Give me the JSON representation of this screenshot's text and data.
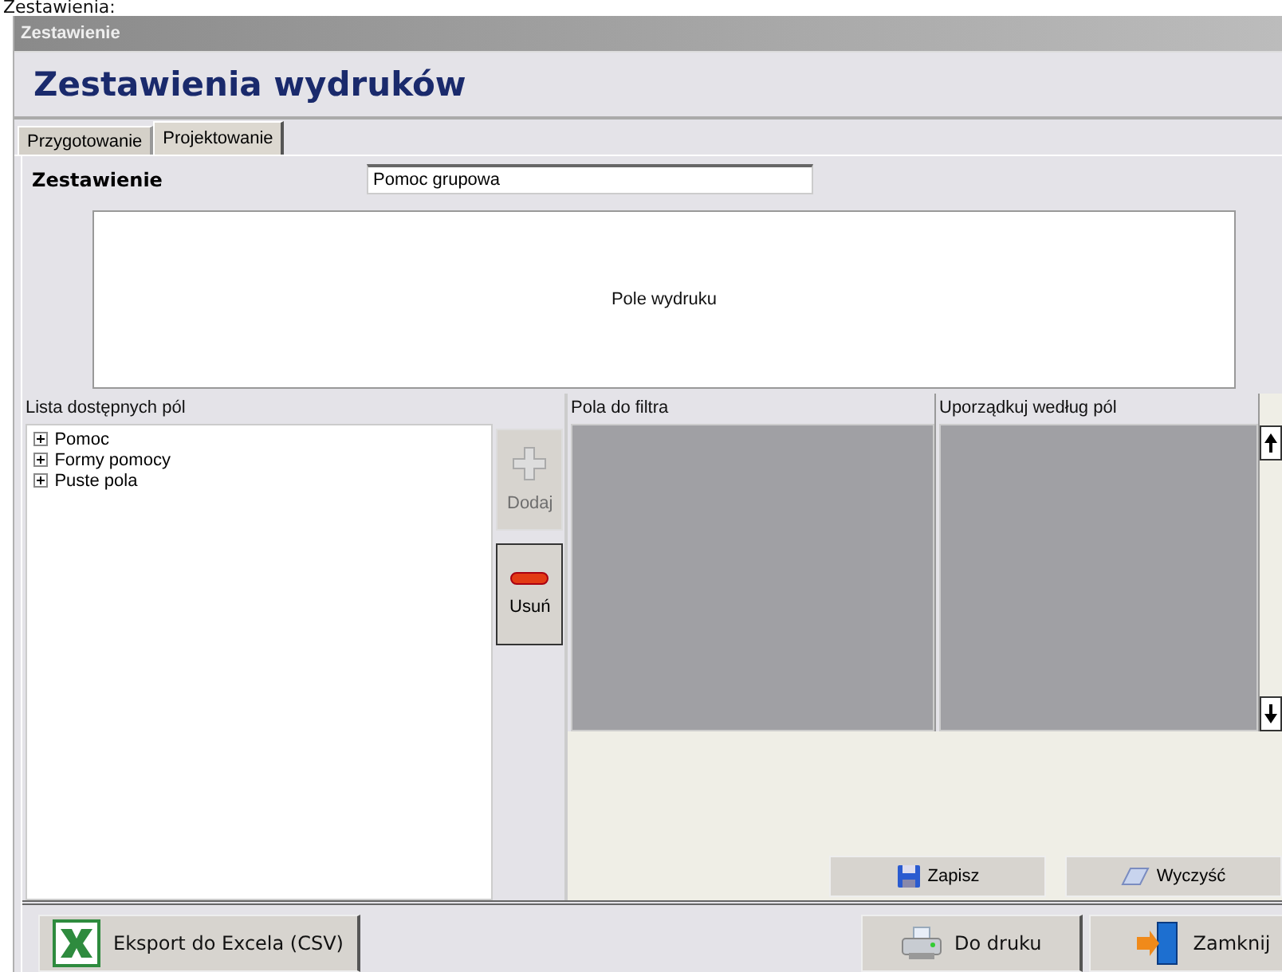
{
  "caption": "Zestawienia:",
  "window": {
    "title": "Zestawienie"
  },
  "heading": "Zestawienia wydruków",
  "tabs": [
    {
      "label": "Przygotowanie",
      "selected": false
    },
    {
      "label": "Projektowanie",
      "selected": true
    }
  ],
  "report": {
    "label": "Zestawienie",
    "value": "Pomoc grupowa"
  },
  "print_area": {
    "label": "Pole wydruku"
  },
  "fields_list": {
    "label": "Lista dostępnych pól",
    "items": [
      {
        "label": "Pomoc",
        "expanded": false
      },
      {
        "label": "Formy pomocy",
        "expanded": false
      },
      {
        "label": "Puste pola",
        "expanded": false
      }
    ]
  },
  "side_buttons": [
    {
      "label": "Dodaj",
      "kind": "add",
      "disabled": true
    },
    {
      "label": "Usuń",
      "kind": "remove",
      "disabled": false
    }
  ],
  "filter_fields": {
    "label": "Pola do filtra"
  },
  "sort_fields": {
    "label": "Uporządkuj według pól"
  },
  "panel_buttons": [
    {
      "label": "Zapisz",
      "kind": "save"
    },
    {
      "label": "Wyczyść",
      "kind": "clear"
    }
  ],
  "footer_buttons": [
    {
      "label": "Eksport do Excela (CSV)",
      "kind": "excel"
    },
    {
      "label": "Do druku",
      "kind": "print"
    },
    {
      "label": "Zamknij",
      "kind": "exit"
    }
  ]
}
